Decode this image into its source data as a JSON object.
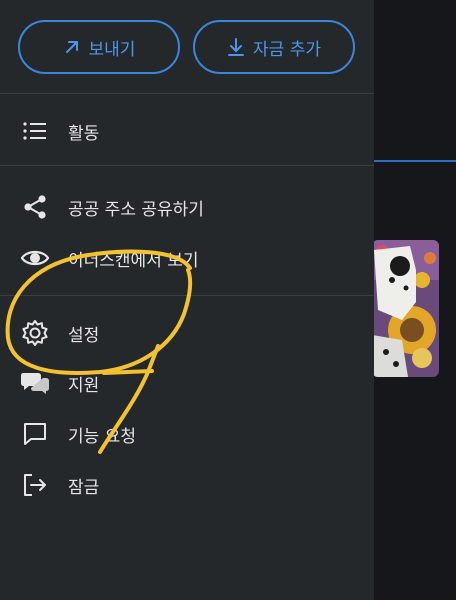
{
  "colors": {
    "drawer_bg": "#25282b",
    "accent": "#3a86db",
    "text": "#e6e6e6",
    "annotation": "#f2c230"
  },
  "buttons": {
    "send": {
      "label": "보내기",
      "icon": "arrow-up-right-icon"
    },
    "add_funds": {
      "label": "자금 추가",
      "icon": "download-icon"
    }
  },
  "menu": {
    "activity": {
      "label": "활동",
      "icon": "list-icon"
    },
    "share_address": {
      "label": "공공 주소 공유하기",
      "icon": "share-icon"
    },
    "view_etherscan": {
      "label": "이더스캔에서 보기",
      "icon": "eye-icon"
    },
    "settings": {
      "label": "설정",
      "icon": "gear-icon"
    },
    "support": {
      "label": "지원",
      "icon": "chat-bubbles-icon"
    },
    "feature_request": {
      "label": "기능 요청",
      "icon": "message-square-icon"
    },
    "lock": {
      "label": "잠금",
      "icon": "logout-icon"
    }
  }
}
